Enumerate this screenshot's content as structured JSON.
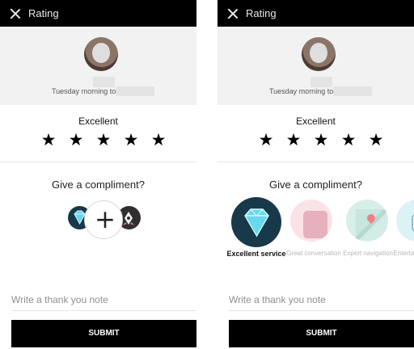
{
  "screens": [
    {
      "header": {
        "title": "Rating"
      },
      "trip": {
        "text": "Tuesday morning to"
      },
      "rating": {
        "label": "Excellent",
        "stars": 5
      },
      "compliments": {
        "title": "Give a compliment?"
      },
      "note": {
        "placeholder": "Write a thank you note"
      },
      "submit": {
        "label": "SUBMIT"
      }
    },
    {
      "header": {
        "title": "Rating"
      },
      "trip": {
        "text": "Tuesday morning to"
      },
      "rating": {
        "label": "Excellent",
        "stars": 5
      },
      "compliments": {
        "title": "Give a compliment?",
        "items": [
          {
            "label": "Excellent service",
            "selected": true
          },
          {
            "label": "Great conversation",
            "selected": false
          },
          {
            "label": "Expert navigation",
            "selected": false
          },
          {
            "label": "Entertaining driver",
            "selected": false
          }
        ]
      },
      "note": {
        "placeholder": "Write a thank you note"
      },
      "submit": {
        "label": "SUBMIT"
      }
    }
  ],
  "colors": {
    "primary": "#000000",
    "panel": "#f2f2f2",
    "muted_text": "#8f8f8f",
    "selected_circle": "#17394a"
  },
  "icons": {
    "close": "close-icon",
    "add": "plus-icon",
    "star": "star-icon"
  }
}
